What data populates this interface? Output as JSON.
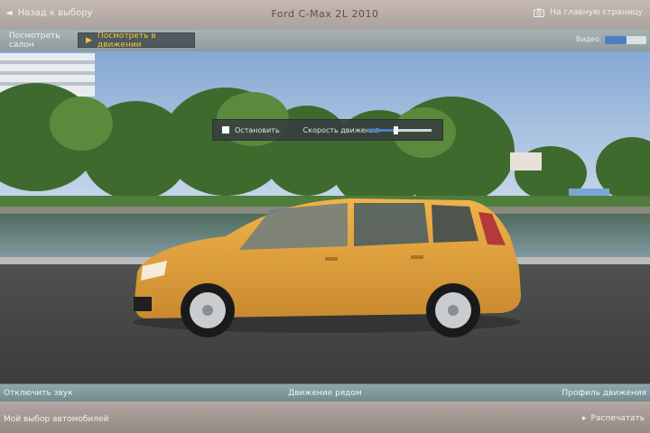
{
  "header": {
    "back_label": "Назад к выбору",
    "title": "Ford C-Max 2L 2010",
    "right_label": "На главную страницу"
  },
  "tabs": [
    {
      "label": "Посмотреть салон"
    },
    {
      "label": "Посмотреть в движении"
    }
  ],
  "tabs_right": {
    "label": "Видео"
  },
  "overlay": {
    "check_label": "Остановить",
    "label2": "Скорость движения"
  },
  "bottom": {
    "left": "Отключить звук",
    "center": "Движение рядом",
    "right": "Профиль движения"
  },
  "footer": {
    "left": "Мой выбор автомобилей",
    "right": "Распечатать"
  },
  "colors": {
    "accent": "#f4c53a",
    "car": "#e1a13d"
  }
}
